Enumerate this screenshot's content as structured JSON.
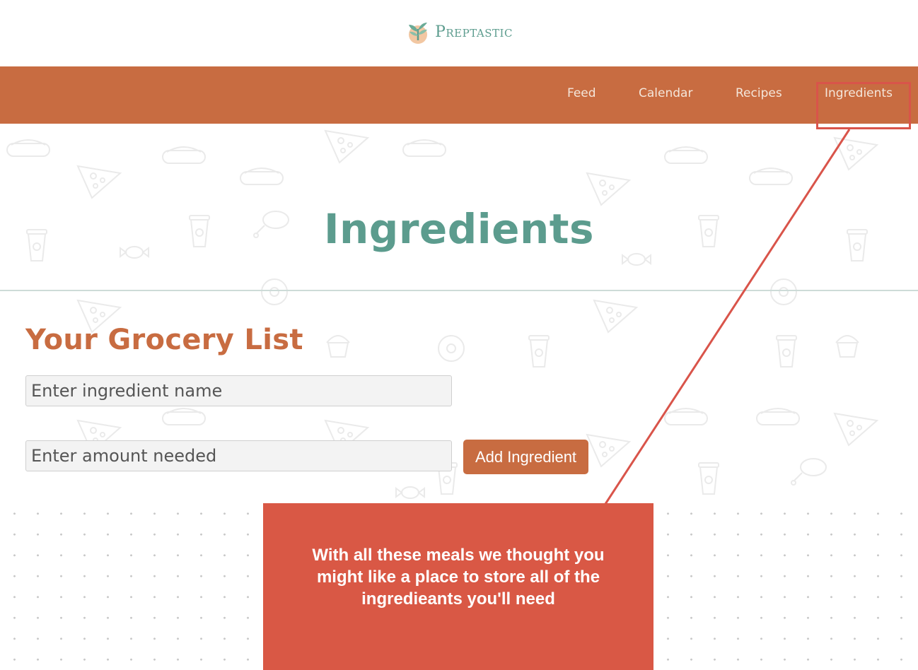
{
  "brand": {
    "name": "Preptastic"
  },
  "nav": {
    "items": [
      {
        "label": "Feed"
      },
      {
        "label": "Calendar"
      },
      {
        "label": "Recipes"
      },
      {
        "label": "Ingredients"
      }
    ],
    "active": "Ingredients"
  },
  "page": {
    "title": "Ingredients"
  },
  "grocery": {
    "heading": "Your Grocery List",
    "name_placeholder": "Enter ingredient name",
    "amount_placeholder": "Enter amount needed",
    "add_button": "Add Ingredient"
  },
  "annotation": {
    "text": "With all these meals we thought you might like a place to store all of the ingredieants you'll need"
  },
  "colors": {
    "brand_teal": "#5c9c8e",
    "brand_orange": "#c86c41",
    "callout_red": "#d95845",
    "highlight_red": "#d9544a"
  }
}
